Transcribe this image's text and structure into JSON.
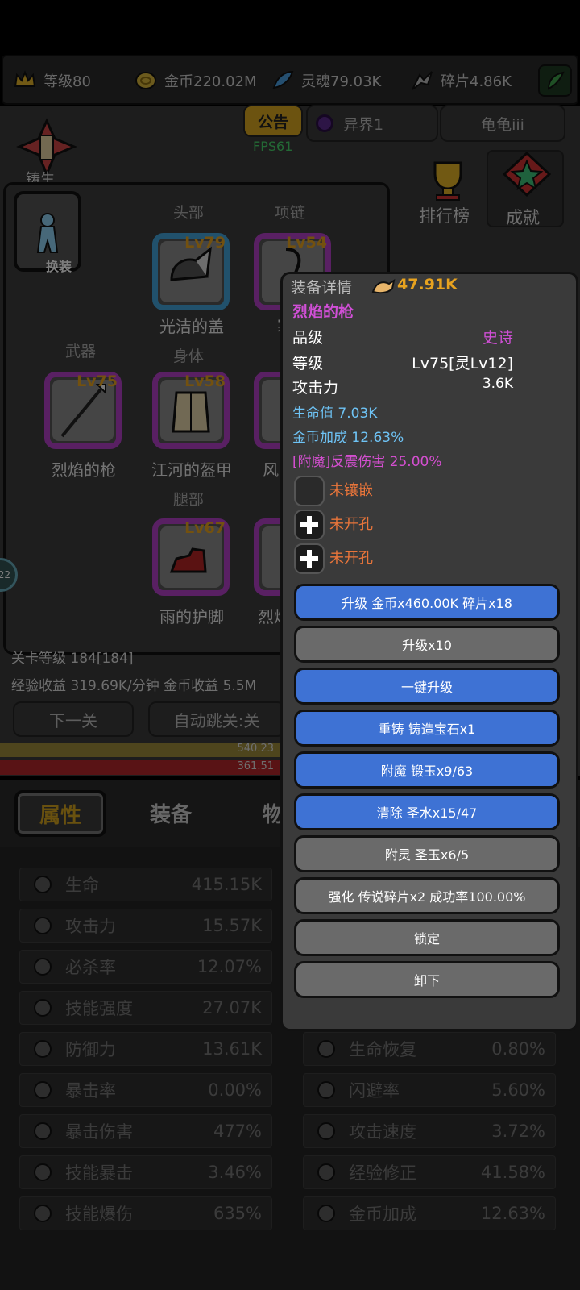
{
  "resources": [
    {
      "icon": "crown-level-icon",
      "text": "等级80"
    },
    {
      "icon": "gold-coin-icon",
      "text": "金币220.02M"
    },
    {
      "icon": "soul-icon",
      "text": "灵魂79.03K"
    },
    {
      "icon": "shard-icon",
      "text": "碎片4.86K"
    }
  ],
  "header": {
    "notice": "公告",
    "fps": "FPS61",
    "realm": "异界1",
    "player": "龟龟iii",
    "ranking": "排行榜",
    "achievement": "成就",
    "forge_partial": "铸生"
  },
  "equip_panel": {
    "change_label": "换装",
    "categories": {
      "head": "头部",
      "necklace": "项链",
      "weapon": "武器",
      "body": "身体",
      "legs": "腿部"
    },
    "slots": [
      {
        "key": "head",
        "lv": "Lv79",
        "name": "光洁的盖",
        "rarity": "blue"
      },
      {
        "key": "necklace",
        "lv": "Lv54",
        "name": "寒冰",
        "rarity": "purple"
      },
      {
        "key": "weapon",
        "lv": "Lv75",
        "name": "烈焰的枪",
        "rarity": "purple"
      },
      {
        "key": "body",
        "lv": "Lv58",
        "name": "江河的盔甲",
        "rarity": "purple"
      },
      {
        "key": "ring",
        "lv": "",
        "name": "风",
        "rarity": "purple"
      },
      {
        "key": "legs",
        "lv": "Lv67",
        "name": "雨的护脚",
        "rarity": "purple"
      },
      {
        "key": "boots2",
        "lv": "",
        "name": "烈焰",
        "rarity": "purple"
      }
    ]
  },
  "stage": {
    "level_text": "关卡等级 184[184]",
    "income_text": "经验收益 319.69K/分钟 金币收益 5.5M",
    "next_btn": "下一关",
    "auto_btn": "自动跳关:关",
    "bar1": "540.23",
    "bar2": "361.51",
    "side_num": "22"
  },
  "tabs": [
    "属性",
    "装备",
    "物"
  ],
  "stats_left": [
    {
      "name": "生命",
      "value": "415.15K",
      "icon": "life-icon"
    },
    {
      "name": "攻击力",
      "value": "15.57K",
      "icon": "sword-icon"
    },
    {
      "name": "必杀率",
      "value": "12.07%",
      "icon": "critical-icon"
    },
    {
      "name": "技能强度",
      "value": "27.07K",
      "icon": "skill-power-icon"
    },
    {
      "name": "防御力",
      "value": "13.61K",
      "icon": "shield-icon"
    },
    {
      "name": "暴击率",
      "value": "0.00%",
      "icon": "fire-icon"
    },
    {
      "name": "暴击伤害",
      "value": "477%",
      "icon": "fire-icon"
    },
    {
      "name": "技能暴击",
      "value": "3.46%",
      "icon": "blue-fire-icon"
    },
    {
      "name": "技能爆伤",
      "value": "635%",
      "icon": "blue-fire-icon"
    }
  ],
  "stats_right": [
    {
      "name": "生命恢复",
      "value": "0.80%",
      "icon": "regen-icon"
    },
    {
      "name": "闪避率",
      "value": "5.60%",
      "icon": "boot-dodge-icon"
    },
    {
      "name": "攻击速度",
      "value": "3.72%",
      "icon": "attack-speed-icon"
    },
    {
      "name": "经验修正",
      "value": "41.58%",
      "icon": "crown-icon"
    },
    {
      "name": "金币加成",
      "value": "12.63%",
      "icon": "coin-icon"
    }
  ],
  "detail": {
    "title": "装备详情",
    "power": "47.91K",
    "item_name": "烈焰的枪",
    "rarity_label": "品级",
    "rarity_value": "史诗",
    "level_label": "等级",
    "level_value": "Lv75[灵Lv12]",
    "atk_label": "攻击力",
    "atk_value": "3.6K",
    "attr1": "生命值 7.03K",
    "attr2": "金币加成 12.63%",
    "attr3": "[附魔]反震伤害 25.00%",
    "gems": [
      "未镶嵌",
      "未开孔",
      "未开孔"
    ],
    "buttons": [
      {
        "label": "升级 金币x460.00K 碎片x18",
        "style": "blue"
      },
      {
        "label": "升级x10",
        "style": "gray"
      },
      {
        "label": "一键升级",
        "style": "blue"
      },
      {
        "label": "重铸 铸造宝石x1",
        "style": "blue"
      },
      {
        "label": "附魔 锻玉x9/63",
        "style": "blue"
      },
      {
        "label": "清除 圣水x15/47",
        "style": "blue"
      },
      {
        "label": "附灵 圣玉x6/5",
        "style": "gray"
      },
      {
        "label": "强化 传说碎片x2 成功率100.00%",
        "style": "gray"
      },
      {
        "label": "锁定",
        "style": "gray"
      },
      {
        "label": "卸下",
        "style": "gray"
      }
    ]
  },
  "colors": {
    "rarity_epic": "#d04fd6",
    "attr_blue": "#6ec3f5",
    "attr_pink": "#d44fd0",
    "gem_orange": "#e9753a",
    "level_gold": "#e7a21f",
    "button_blue": "#3e72d4",
    "button_gray": "#6a6a6a"
  }
}
